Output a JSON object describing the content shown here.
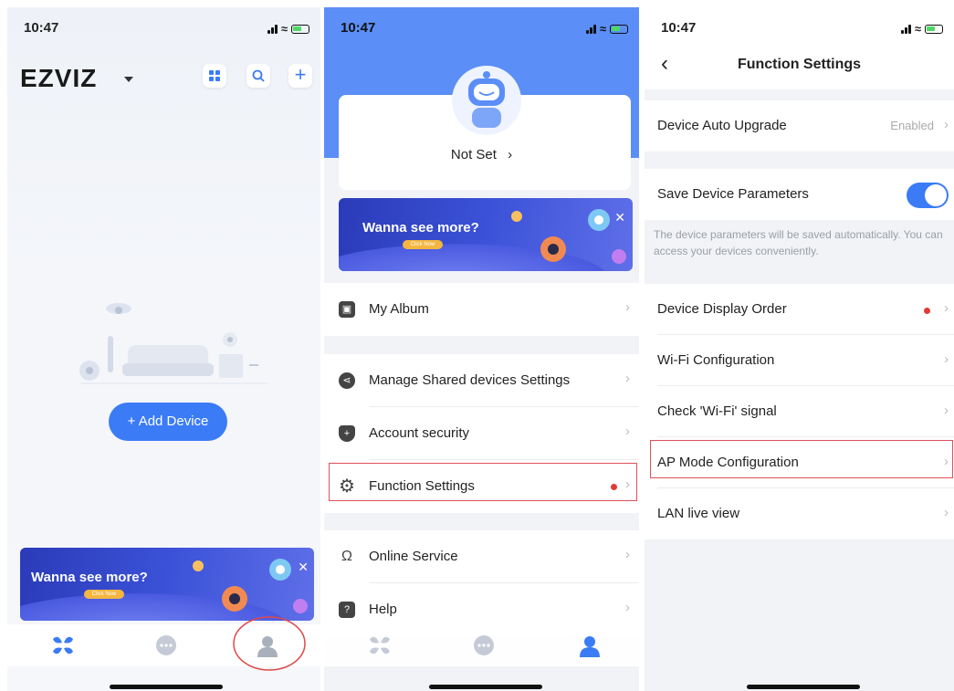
{
  "screen1": {
    "status_time": "10:47",
    "logo": "EZVIZ",
    "add_device_label": "+ Add Device",
    "banner": {
      "headline": "Wanna see more?",
      "cta": "Click Now"
    },
    "tabbar": [
      "home-icon",
      "message-icon",
      "profile-icon"
    ],
    "accent": "#3b7bf6"
  },
  "screen2": {
    "status_time": "10:47",
    "profile_name": "Not Set",
    "banner": {
      "headline": "Wanna see more?",
      "cta": "Click Now"
    },
    "menu": {
      "album": "My Album",
      "shared": "Manage Shared devices Settings",
      "security": "Account security",
      "function": "Function Settings",
      "online": "Online Service",
      "help": "Help"
    }
  },
  "screen3": {
    "status_time": "10:47",
    "title": "Function Settings",
    "auto_upgrade": {
      "label": "Device Auto Upgrade",
      "value": "Enabled"
    },
    "save_params": {
      "label": "Save Device Parameters",
      "enabled": true
    },
    "hint": "The device parameters will be saved automatically. You can access your devices conveniently.",
    "rows": {
      "display_order": "Device Display Order",
      "wifi_config": "Wi-Fi Configuration",
      "wifi_signal": "Check 'Wi-Fi' signal",
      "ap_mode": "AP Mode Configuration",
      "lan_live": "LAN live view"
    }
  }
}
